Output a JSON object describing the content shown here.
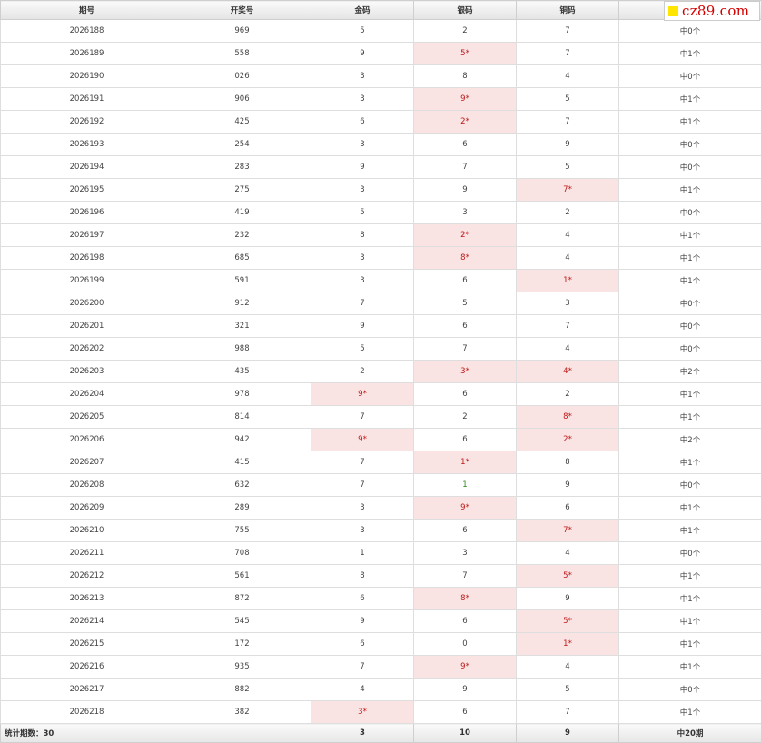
{
  "logo": {
    "text": "cz89.com",
    "brand_color": "#d40000",
    "square_color": "#ffe500"
  },
  "headers": [
    "期号",
    "开奖号",
    "金码",
    "银码",
    "铜码",
    ""
  ],
  "rows": [
    [
      "2026188",
      "969",
      "5",
      "2",
      "7",
      "中0个"
    ],
    [
      "2026189",
      "558",
      "9",
      "5*",
      "7",
      "中1个"
    ],
    [
      "2026190",
      "026",
      "3",
      "8",
      "4",
      "中0个"
    ],
    [
      "2026191",
      "906",
      "3",
      "9*",
      "5",
      "中1个"
    ],
    [
      "2026192",
      "425",
      "6",
      "2*",
      "7",
      "中1个"
    ],
    [
      "2026193",
      "254",
      "3",
      "6",
      "9",
      "中0个"
    ],
    [
      "2026194",
      "283",
      "9",
      "7",
      "5",
      "中0个"
    ],
    [
      "2026195",
      "275",
      "3",
      "9",
      "7*",
      "中1个"
    ],
    [
      "2026196",
      "419",
      "5",
      "3",
      "2",
      "中0个"
    ],
    [
      "2026197",
      "232",
      "8",
      "2*",
      "4",
      "中1个"
    ],
    [
      "2026198",
      "685",
      "3",
      "8*",
      "4",
      "中1个"
    ],
    [
      "2026199",
      "591",
      "3",
      "6",
      "1*",
      "中1个"
    ],
    [
      "2026200",
      "912",
      "7",
      "5",
      "3",
      "中0个"
    ],
    [
      "2026201",
      "321",
      "9",
      "6",
      "7",
      "中0个"
    ],
    [
      "2026202",
      "988",
      "5",
      "7",
      "4",
      "中0个"
    ],
    [
      "2026203",
      "435",
      "2",
      "3*",
      "4*",
      "中2个"
    ],
    [
      "2026204",
      "978",
      "9*",
      "6",
      "2",
      "中1个"
    ],
    [
      "2026205",
      "814",
      "7",
      "2",
      "8*",
      "中1个"
    ],
    [
      "2026206",
      "942",
      "9*",
      "6",
      "2*",
      "中2个"
    ],
    [
      "2026207",
      "415",
      "7",
      "1*",
      "8",
      "中1个"
    ],
    [
      "2026208",
      "632",
      "7",
      "1",
      "9",
      "中0个"
    ],
    [
      "2026209",
      "289",
      "3",
      "9*",
      "6",
      "中1个"
    ],
    [
      "2026210",
      "755",
      "3",
      "6",
      "7*",
      "中1个"
    ],
    [
      "2026211",
      "708",
      "1",
      "3",
      "4",
      "中0个"
    ],
    [
      "2026212",
      "561",
      "8",
      "7",
      "5*",
      "中1个"
    ],
    [
      "2026213",
      "872",
      "6",
      "8*",
      "9",
      "中1个"
    ],
    [
      "2026214",
      "545",
      "9",
      "6",
      "5*",
      "中1个"
    ],
    [
      "2026215",
      "172",
      "6",
      "0",
      "1*",
      "中1个"
    ],
    [
      "2026216",
      "935",
      "7",
      "9*",
      "4",
      "中1个"
    ],
    [
      "2026217",
      "882",
      "4",
      "9",
      "5",
      "中0个"
    ],
    [
      "2026218",
      "382",
      "3*",
      "6",
      "7",
      "中1个"
    ]
  ],
  "footer": {
    "label": "统计期数：30",
    "gold": "3",
    "silver": "10",
    "copper": "9",
    "total": "中20期"
  },
  "colors": {
    "hit_bg": "#f9e3e3",
    "hit_text": "#c01818",
    "green_text": "#2f8a1c"
  }
}
